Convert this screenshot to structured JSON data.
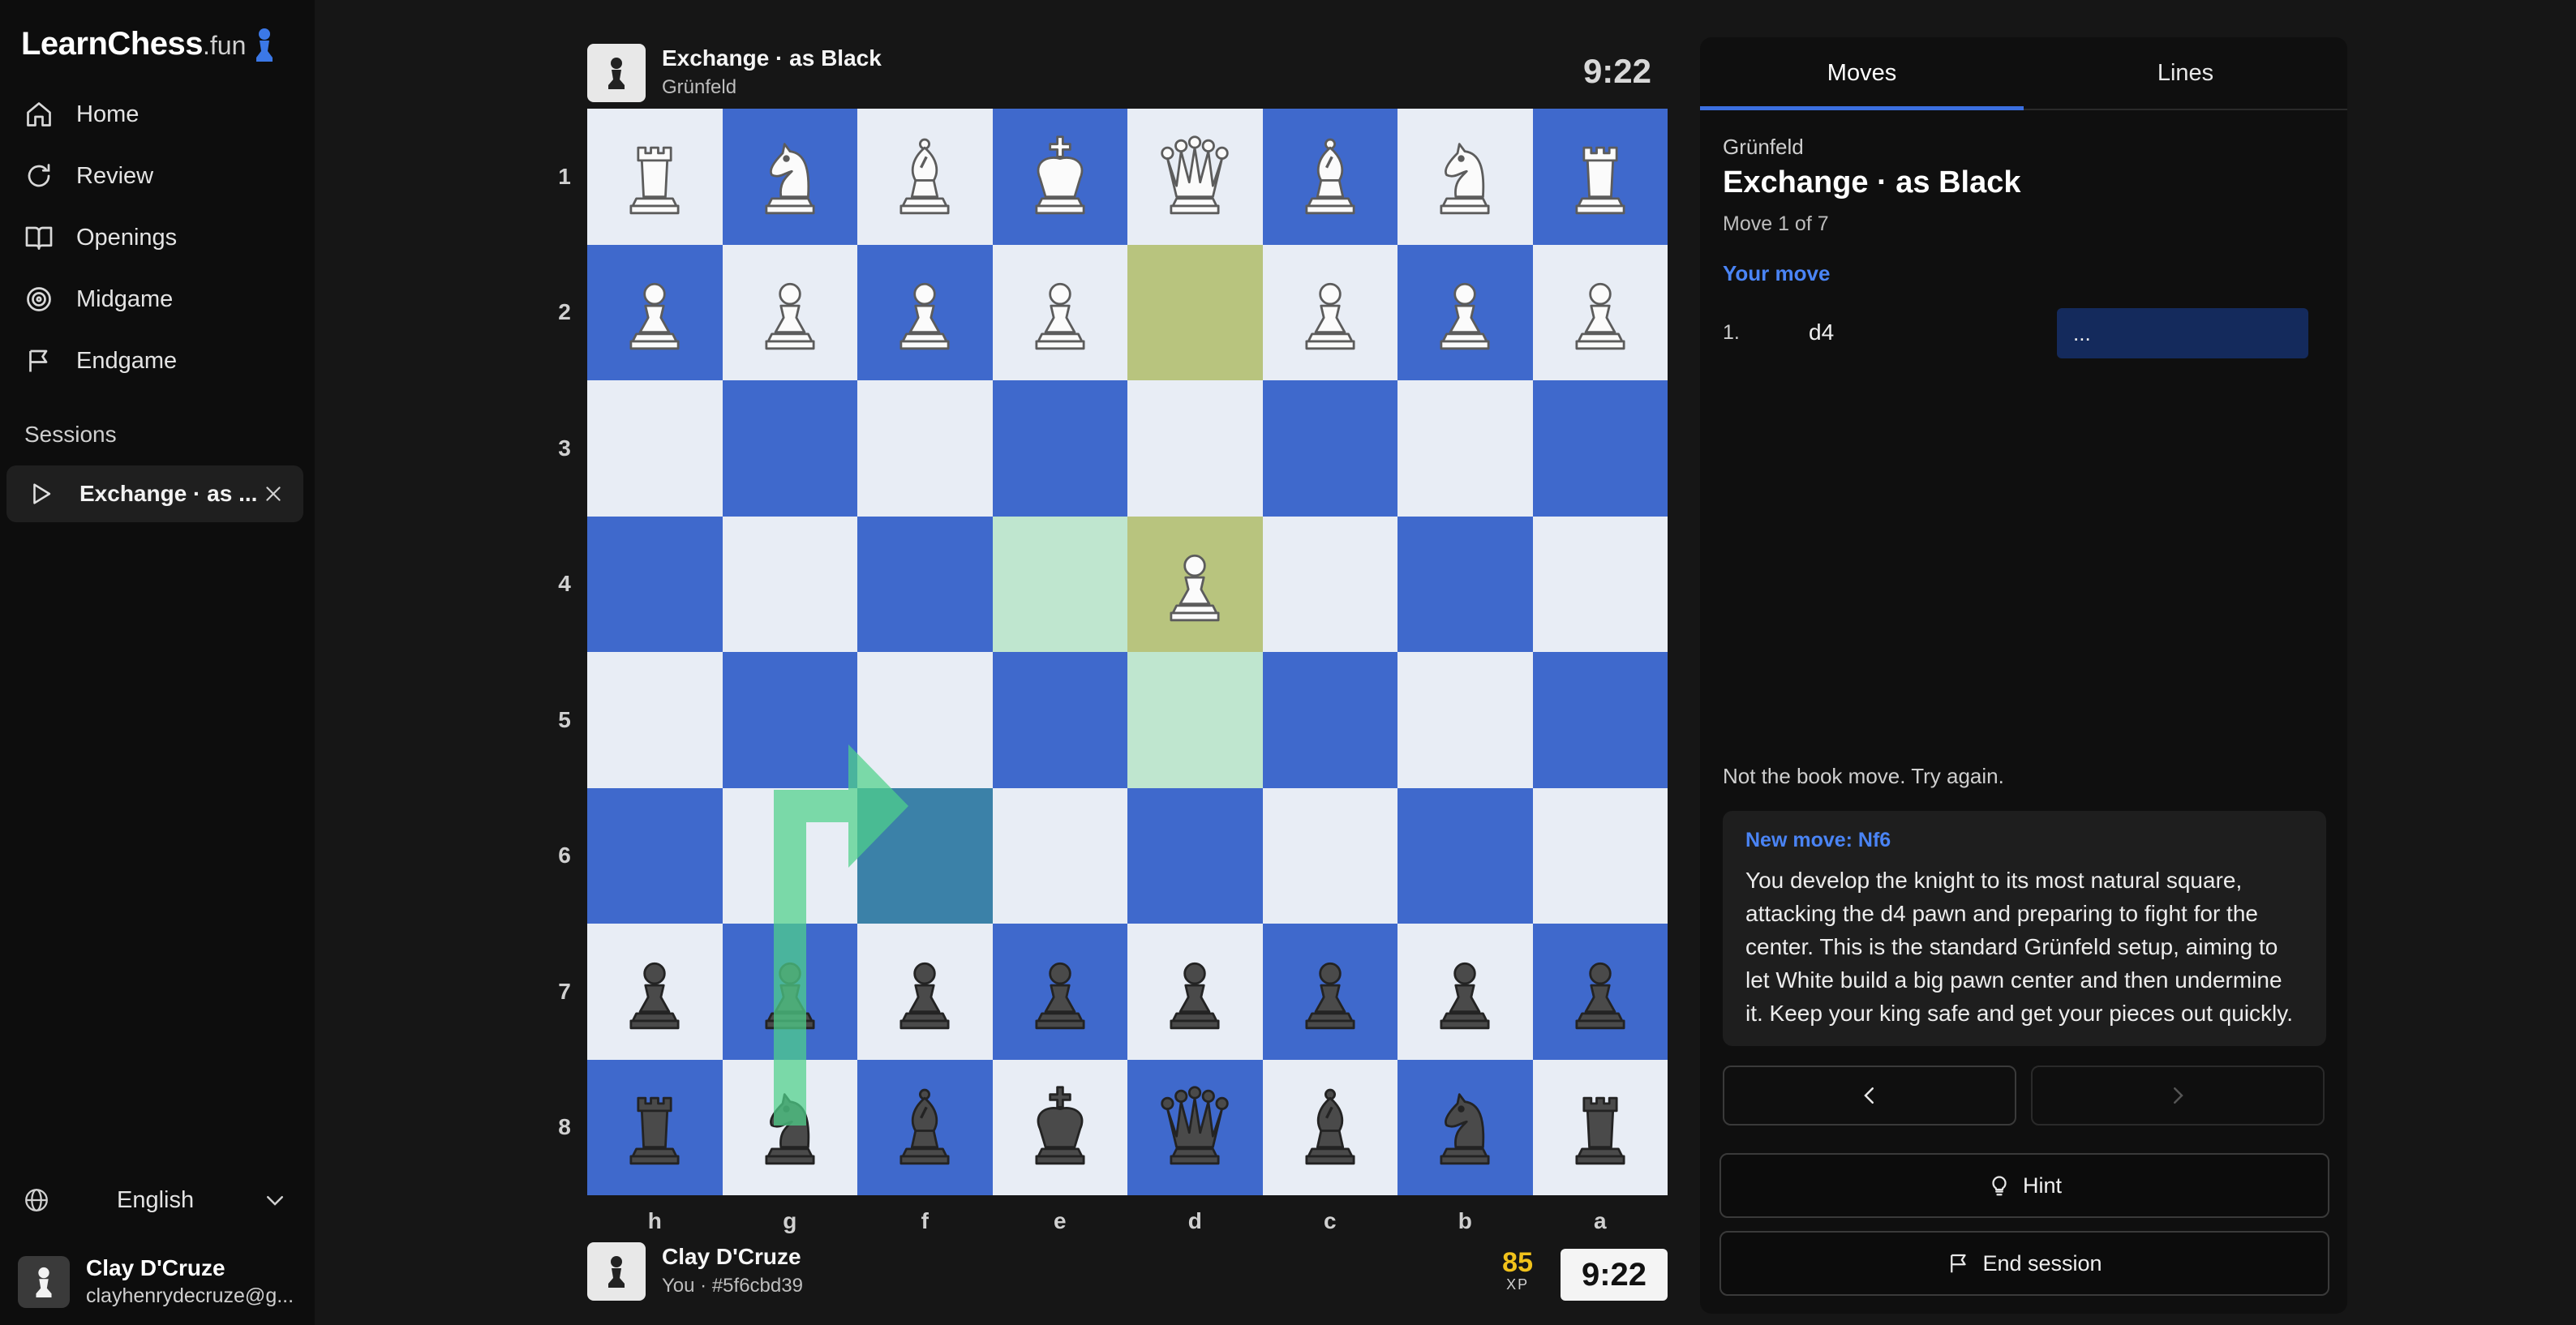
{
  "app": {
    "logo_main": "LearnChess",
    "logo_sub": ".fun"
  },
  "sidebar": {
    "nav": [
      {
        "label": "Home",
        "icon": "home-icon"
      },
      {
        "label": "Review",
        "icon": "refresh-icon"
      },
      {
        "label": "Openings",
        "icon": "book-icon"
      },
      {
        "label": "Midgame",
        "icon": "target-icon"
      },
      {
        "label": "Endgame",
        "icon": "flag-icon"
      }
    ],
    "sessions_title": "Sessions",
    "session_item": "Exchange · as ...",
    "language": "English",
    "user": {
      "name": "Clay D'Cruze",
      "email": "clayhenrydecruze@g..."
    }
  },
  "top_player": {
    "name": "Exchange · as Black",
    "sub": "Grünfeld",
    "clock": "9:22"
  },
  "bottom_player": {
    "name": "Clay D'Cruze",
    "sub": "You · #5f6cbd39",
    "xp": "85",
    "xp_unit": "XP",
    "clock": "9:22"
  },
  "board": {
    "orientation": "black",
    "ranks": [
      "1",
      "2",
      "3",
      "4",
      "5",
      "6",
      "7",
      "8"
    ],
    "files": [
      "h",
      "g",
      "f",
      "e",
      "d",
      "c",
      "b",
      "a"
    ],
    "rows": [
      [
        "wR",
        "wN",
        "wB",
        "wK",
        "wQ",
        "wB",
        "wN",
        "wR"
      ],
      [
        "wP",
        "wP",
        "wP",
        "wP",
        "",
        "wP",
        "wP",
        "wP"
      ],
      [
        "",
        "",
        "",
        "",
        "",
        "",
        "",
        ""
      ],
      [
        "",
        "",
        "",
        "",
        "wP",
        "",
        "",
        ""
      ],
      [
        "",
        "",
        "",
        "",
        "",
        "",
        "",
        ""
      ],
      [
        "",
        "",
        "",
        "",
        "",
        "",
        "",
        ""
      ],
      [
        "bP",
        "bP",
        "bP",
        "bP",
        "bP",
        "bP",
        "bP",
        "bP"
      ],
      [
        "bR",
        "bN",
        "bB",
        "bK",
        "bQ",
        "bB",
        "bN",
        "bR"
      ]
    ],
    "colors": {
      "light": "#e8edf5",
      "dark": "#3f69cc",
      "last_move": "#b8c47e",
      "hint": "#bfe6cf",
      "target": "#3b81a8",
      "arrow": "#4fd18b"
    }
  },
  "panel": {
    "tabs": [
      "Moves",
      "Lines"
    ],
    "opening": "Grünfeld",
    "line_title": "Exchange · as Black",
    "move_count": "Move 1 of 7",
    "your_move": "Your move",
    "moves": [
      {
        "num": "1.",
        "white": "d4",
        "black": "..."
      }
    ],
    "feedback": "Not the book move. Try again.",
    "explain_title": "New move: Nf6",
    "explain_body": "You develop the knight to its most natural square, attacking the d4 pawn and preparing to fight for the center. This is the standard Grünfeld setup, aiming to let White build a big pawn center and then undermine it. Keep your king safe and get your pieces out quickly.",
    "hint_label": "Hint",
    "end_label": "End session",
    "accent": "#4a84f5"
  }
}
